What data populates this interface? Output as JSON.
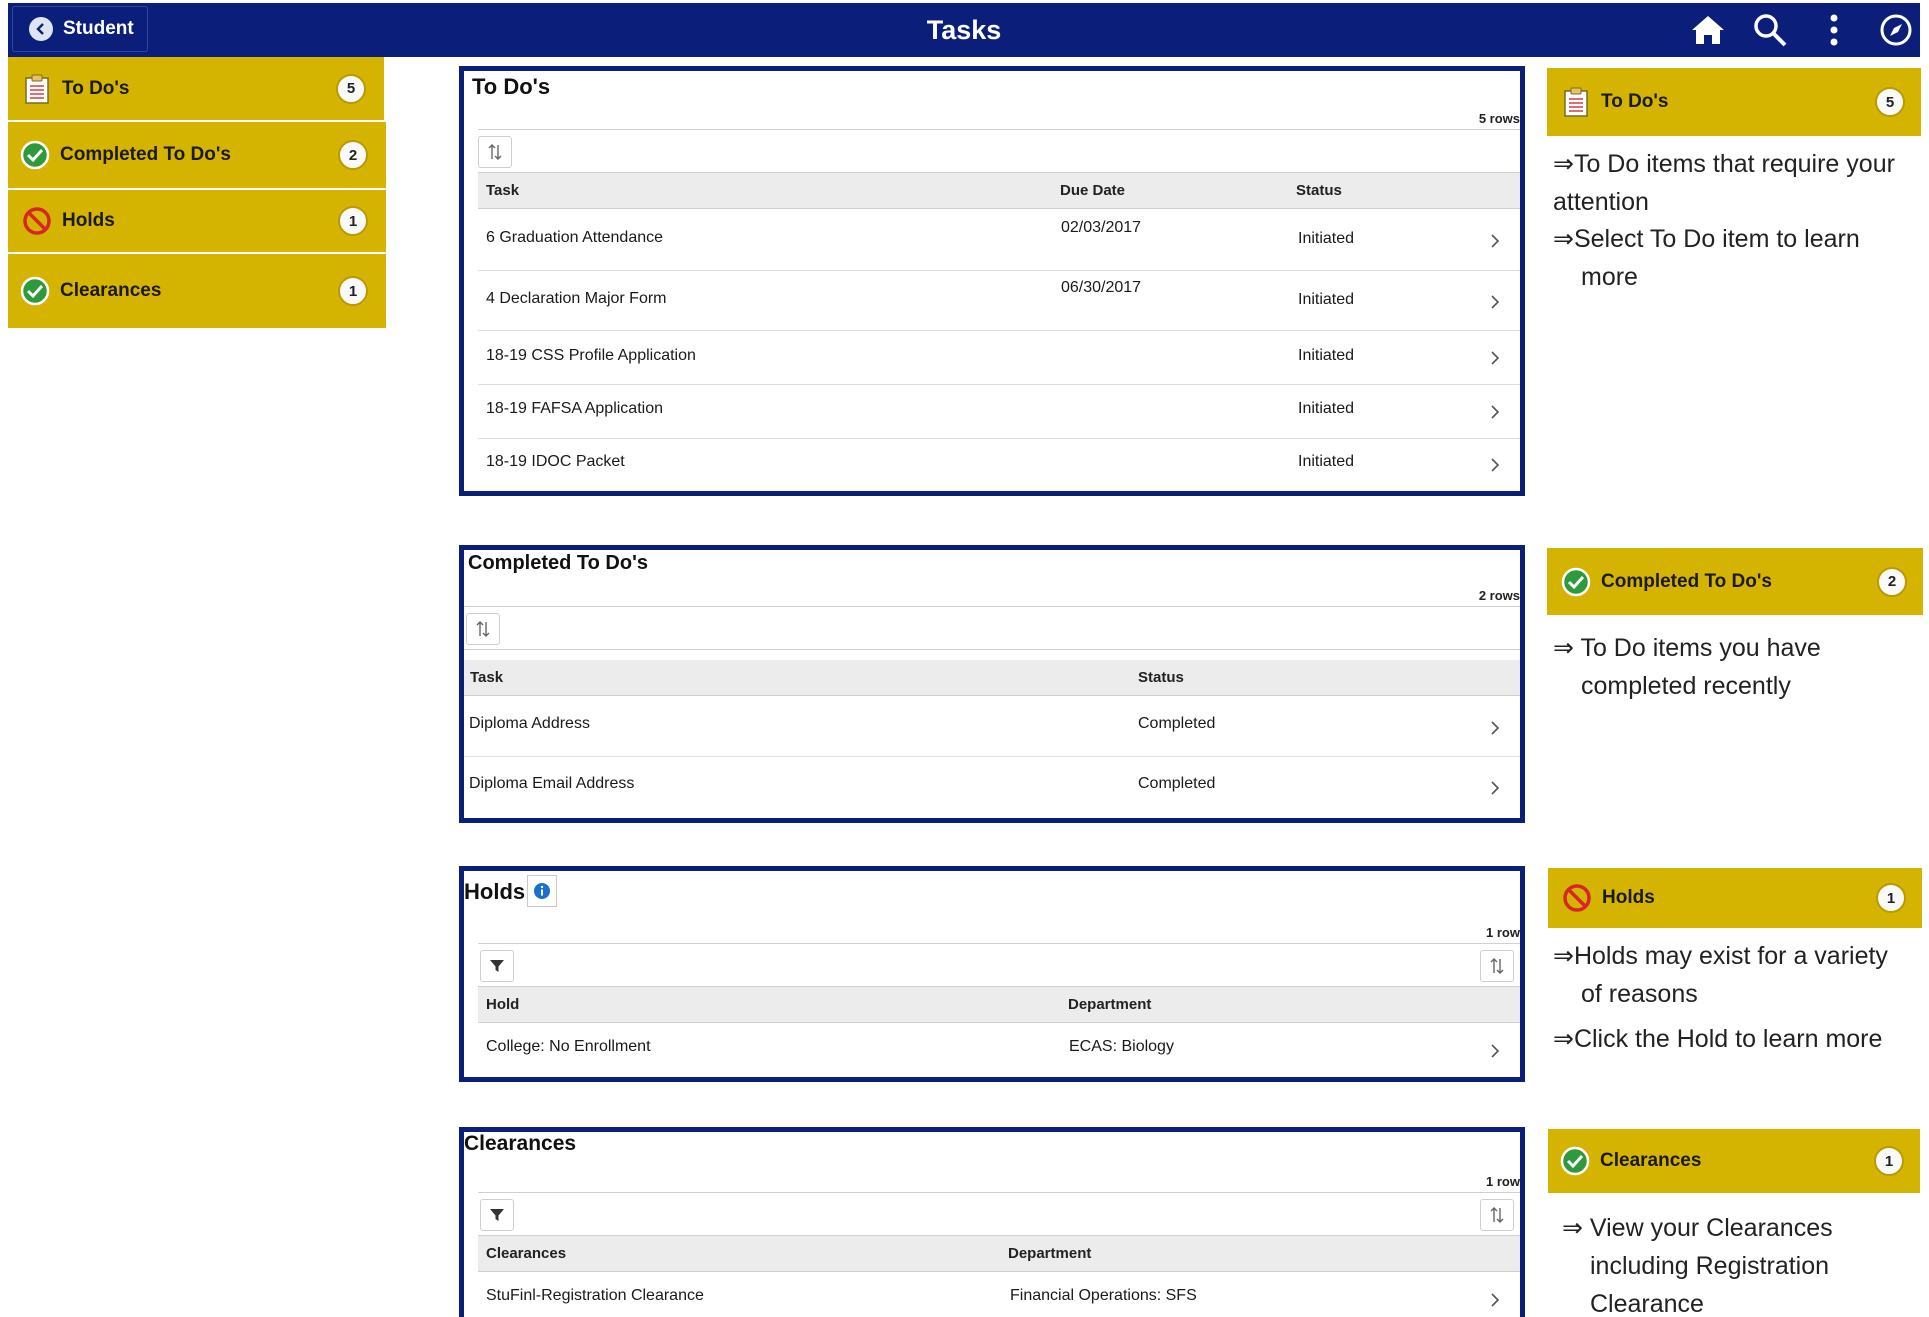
{
  "header": {
    "back_label": "Student",
    "title": "Tasks",
    "icons": [
      "home-icon",
      "search-icon",
      "more-vertical-icon",
      "navigator-icon"
    ]
  },
  "colors": {
    "header": "#0b1f7a",
    "tile": "#d4b400",
    "panel_border": "#0b1f7a"
  },
  "sidebar": {
    "items": [
      {
        "label": "To Do's",
        "count": "5",
        "icon": "clipboard-icon"
      },
      {
        "label": "Completed To Do's",
        "count": "2",
        "icon": "check-circle-icon"
      },
      {
        "label": "Holds",
        "count": "1",
        "icon": "prohibited-icon"
      },
      {
        "label": "Clearances",
        "count": "1",
        "icon": "check-circle-icon"
      }
    ]
  },
  "todos": {
    "title": "To Do's",
    "rows_label": "5 rows",
    "columns": [
      "Task",
      "Due Date",
      "Status"
    ],
    "rows": [
      {
        "task": "6 Graduation Attendance",
        "due": "02/03/2017",
        "status": "Initiated"
      },
      {
        "task": "4 Declaration Major Form",
        "due": "06/30/2017",
        "status": "Initiated"
      },
      {
        "task": "18-19 CSS Profile Application",
        "due": "",
        "status": "Initiated"
      },
      {
        "task": "18-19 FAFSA Application",
        "due": "",
        "status": "Initiated"
      },
      {
        "task": "18-19 IDOC Packet",
        "due": "",
        "status": "Initiated"
      }
    ]
  },
  "completed": {
    "title": "Completed To Do's",
    "rows_label": "2 rows",
    "columns": [
      "Task",
      "Status"
    ],
    "rows": [
      {
        "task": "Diploma Address",
        "status": "Completed"
      },
      {
        "task": "Diploma Email Address",
        "status": "Completed"
      }
    ]
  },
  "holds": {
    "title": "Holds",
    "rows_label": "1 row",
    "columns": [
      "Hold",
      "Department"
    ],
    "rows": [
      {
        "hold": "College: No Enrollment",
        "department": "ECAS: Biology"
      }
    ]
  },
  "clearances": {
    "title": "Clearances",
    "rows_label": "1 row",
    "columns": [
      "Clearances",
      "Department"
    ],
    "rows": [
      {
        "clearance": "StuFinl-Registration Clearance",
        "department": "Financial Operations: SFS"
      }
    ]
  },
  "notes": {
    "todos": {
      "tile_label": "To Do's",
      "count": "5",
      "line1a": "⇒To Do items that require your",
      "line1b": "attention",
      "line2a": "⇒Select To Do item to learn",
      "line2b": "more"
    },
    "completed": {
      "tile_label": "Completed To Do's",
      "count": "2",
      "line1a": "⇒ To Do items you have",
      "line1b": "completed recently"
    },
    "holds": {
      "tile_label": "Holds",
      "count": "1",
      "line1a": "⇒Holds may exist for a variety",
      "line1b": "of reasons",
      "line2a": "⇒Click the Hold to learn more"
    },
    "clearances": {
      "tile_label": "Clearances",
      "count": "1",
      "line1a": "⇒ View your Clearances",
      "line1b": "including Registration",
      "line1c": "Clearance"
    }
  }
}
